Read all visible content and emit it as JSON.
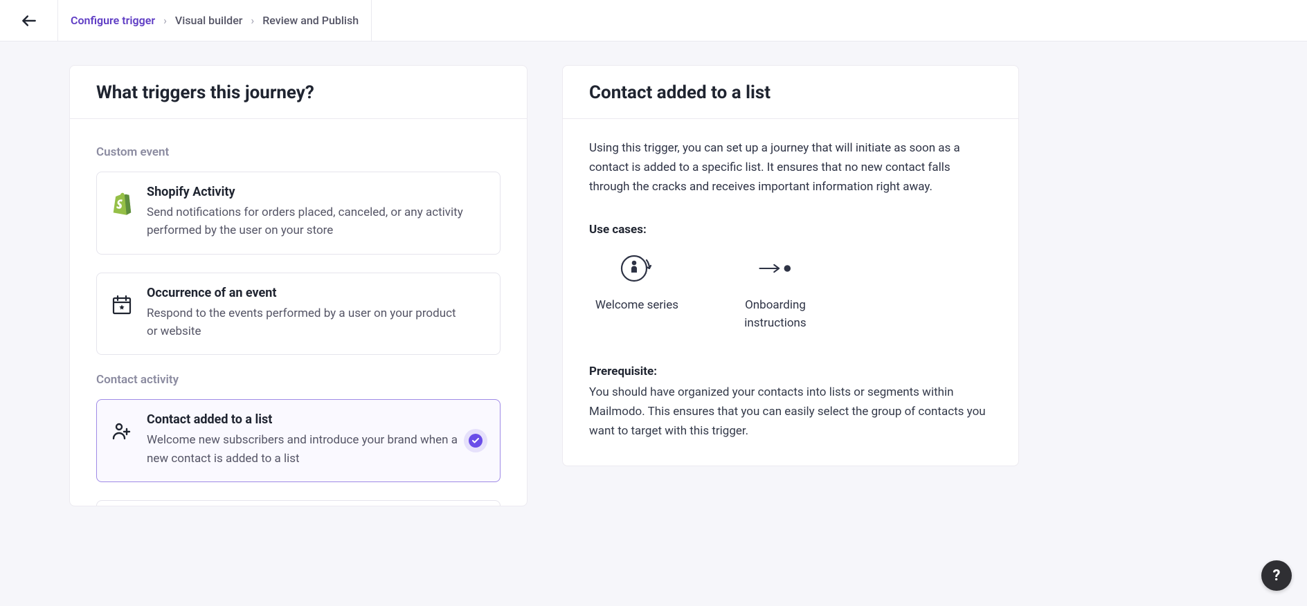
{
  "breadcrumb": {
    "items": [
      {
        "label": "Configure trigger",
        "active": true
      },
      {
        "label": "Visual builder",
        "active": false
      },
      {
        "label": "Review and Publish",
        "active": false
      }
    ]
  },
  "left": {
    "title": "What triggers this journey?",
    "groups": [
      {
        "label": "Custom event",
        "cards": [
          {
            "icon": "shopify",
            "title": "Shopify Activity",
            "desc": "Send notifications for orders placed, canceled, or any activity performed by the user on your store",
            "selected": false
          },
          {
            "icon": "calendar",
            "title": "Occurrence of an event",
            "desc": "Respond to the events performed by a user on your product or website",
            "selected": false
          }
        ]
      },
      {
        "label": "Contact activity",
        "cards": [
          {
            "icon": "user-plus",
            "title": "Contact added to a list",
            "desc": "Welcome new subscribers and introduce your brand when a new contact is added to a list",
            "selected": true
          }
        ]
      }
    ]
  },
  "right": {
    "title": "Contact added to a list",
    "para": "Using this trigger, you can set up a journey that will initiate as soon as a contact is added to a specific list. It ensures that no new contact falls through the cracks and receives important information right away.",
    "usecases_label": "Use cases:",
    "usecases": [
      {
        "icon": "welcome",
        "label": "Welcome series"
      },
      {
        "icon": "onboarding",
        "label": "Onboarding instructions"
      }
    ],
    "prereq_label": "Prerequisite:",
    "prereq_text": "You should have organized your contacts into lists or segments within Mailmodo. This ensures that you can easily select the group of contacts you want to target with this trigger."
  },
  "help": {
    "glyph": "?"
  }
}
